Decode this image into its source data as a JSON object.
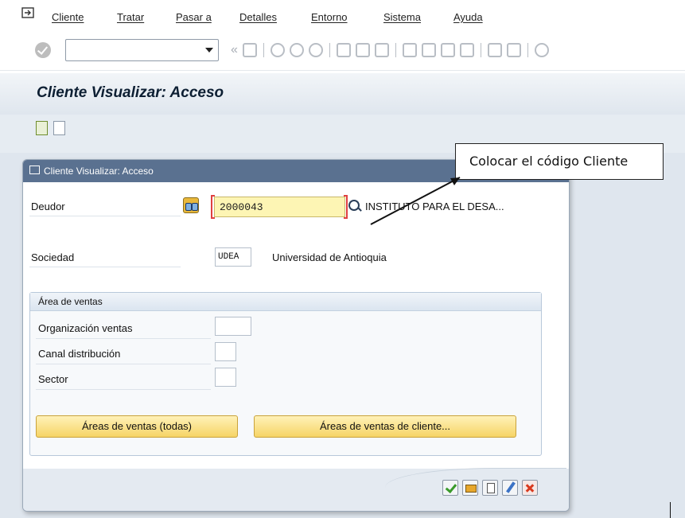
{
  "menu": {
    "items": [
      "Cliente",
      "Tratar",
      "Pasar a",
      "Detalles",
      "Entorno",
      "Sistema",
      "Ayuda"
    ]
  },
  "toolbar": {
    "command_field_value": "",
    "icons": [
      "ok-icon",
      "save-icon",
      "back-icon",
      "exit-icon",
      "cancel-icon",
      "print-icon",
      "find-icon",
      "find-next-icon",
      "first-page-icon",
      "prev-page-icon",
      "next-page-icon",
      "last-page-icon",
      "new-session-icon",
      "shortcut-icon",
      "help-icon"
    ]
  },
  "page": {
    "title": "Cliente Visualizar: Acceso"
  },
  "dialog": {
    "title": "Cliente Visualizar: Acceso",
    "deudor_label": "Deudor",
    "deudor_value": "2000043",
    "deudor_description": "INSTITUTO PARA EL DESA...",
    "sociedad_label": "Sociedad",
    "sociedad_value": "UDEA",
    "sociedad_description": "Universidad de Antioquia",
    "sales_area_title": "Área de ventas",
    "sales_org_label": "Organización ventas",
    "sales_org_value": "",
    "distribution_channel_label": "Canal distribución",
    "distribution_channel_value": "",
    "sector_label": "Sector",
    "sector_value": "",
    "btn_all_sales_areas": "Áreas de ventas (todas)",
    "btn_customer_sales_areas": "Áreas de ventas de cliente..."
  },
  "callout": {
    "text": "Colocar el código Cliente"
  },
  "colors": {
    "title_bar": "#5a7190",
    "input_highlight": "#fdf5b4",
    "button_yellow": "#f6d466",
    "ok_green": "#3a9a2a",
    "cancel_red": "#d83a1f"
  }
}
